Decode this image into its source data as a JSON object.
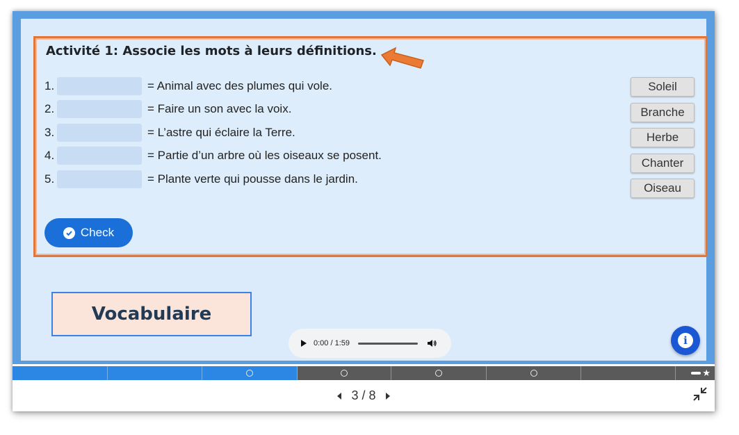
{
  "activity": {
    "title": "Activité 1: Associe les mots à leurs définitions.",
    "items": [
      {
        "num": "1.",
        "definition": "= Animal avec des plumes qui vole."
      },
      {
        "num": "2.",
        "definition": "= Faire un son avec la voix."
      },
      {
        "num": "3.",
        "definition": "= L’astre qui éclaire la Terre."
      },
      {
        "num": "4.",
        "definition": "= Partie d’un arbre où les oiseaux se posent."
      },
      {
        "num": "5.",
        "definition": "= Plante verte qui pousse dans le jardin."
      }
    ],
    "words": [
      "Soleil",
      "Branche",
      "Herbe",
      "Chanter",
      "Oiseau"
    ],
    "check_label": "Check",
    "annotation_arrow_icon": "arrow-pointing-left-icon"
  },
  "vocab_label": "Vocabulaire",
  "audio": {
    "time": "0:00 / 1:59"
  },
  "info_icon": "info-icon",
  "progress": {
    "segments": 8,
    "current": 3,
    "has_star_end": true
  },
  "navigation": {
    "page": "3 / 8"
  },
  "colors": {
    "accent": "#1b6fd8",
    "frame_blue": "#5a9de0",
    "highlight_border": "#e0763a",
    "vocab_bg": "#fbe4da"
  }
}
